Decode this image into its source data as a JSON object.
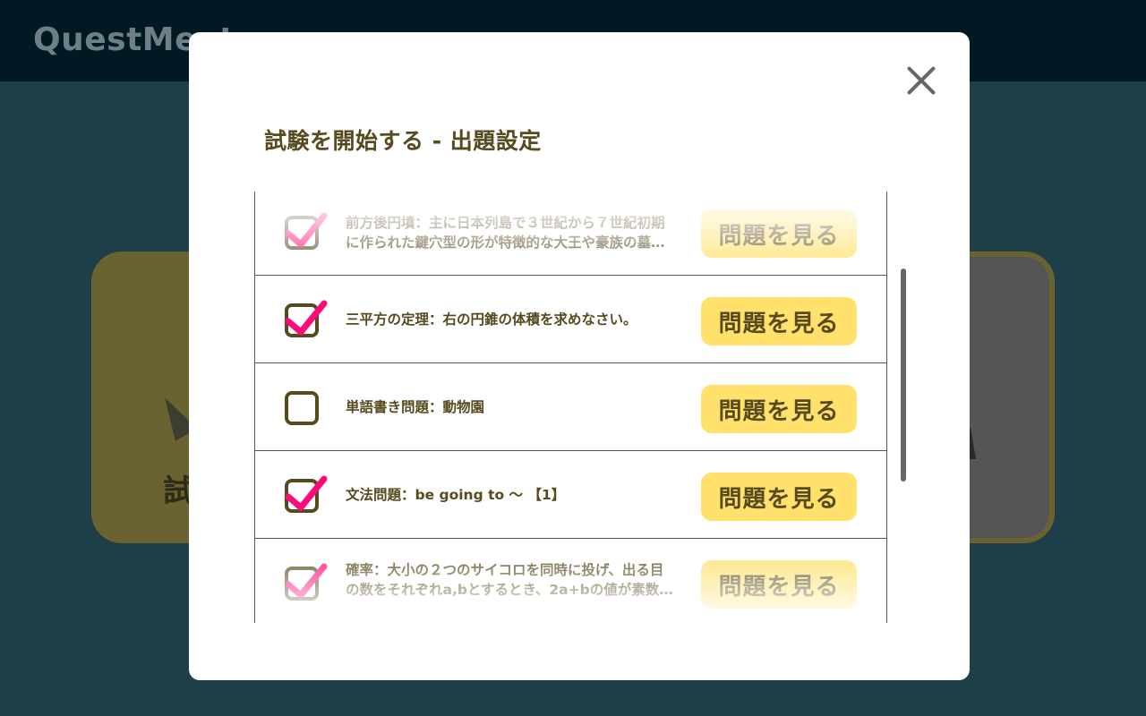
{
  "app": {
    "brand": "QuestMeet"
  },
  "background": {
    "card_left_glyph": "試"
  },
  "modal": {
    "title": "試験を開始する - 出題設定",
    "close_icon": "close-icon",
    "view_button_label": "問題を見る",
    "rows": [
      {
        "checked": true,
        "lines": [
          "前方後円墳：主に日本列島で３世紀から７世紀初期",
          "に作られた鍵穴型の形が特徴的な大王や豪族の墓…"
        ]
      },
      {
        "checked": true,
        "lines": [
          "三平方の定理：右の円錐の体積を求めなさい。"
        ]
      },
      {
        "checked": false,
        "lines": [
          "単語書き問題：動物園"
        ]
      },
      {
        "checked": true,
        "lines": [
          "文法問題：be going to 〜 【1】"
        ]
      },
      {
        "checked": true,
        "lines": [
          "確率：大小の２つのサイコロを同時に投げ、出る目",
          "の数をそれぞれa,bとするとき、2a+bの値が素数…"
        ]
      }
    ]
  },
  "colors": {
    "accent_yellow": "#ffe16b",
    "check_pink": "#ff0a78",
    "text_brown": "#574a1e",
    "header_dark": "#001922",
    "page_bg": "#1f3f48"
  }
}
